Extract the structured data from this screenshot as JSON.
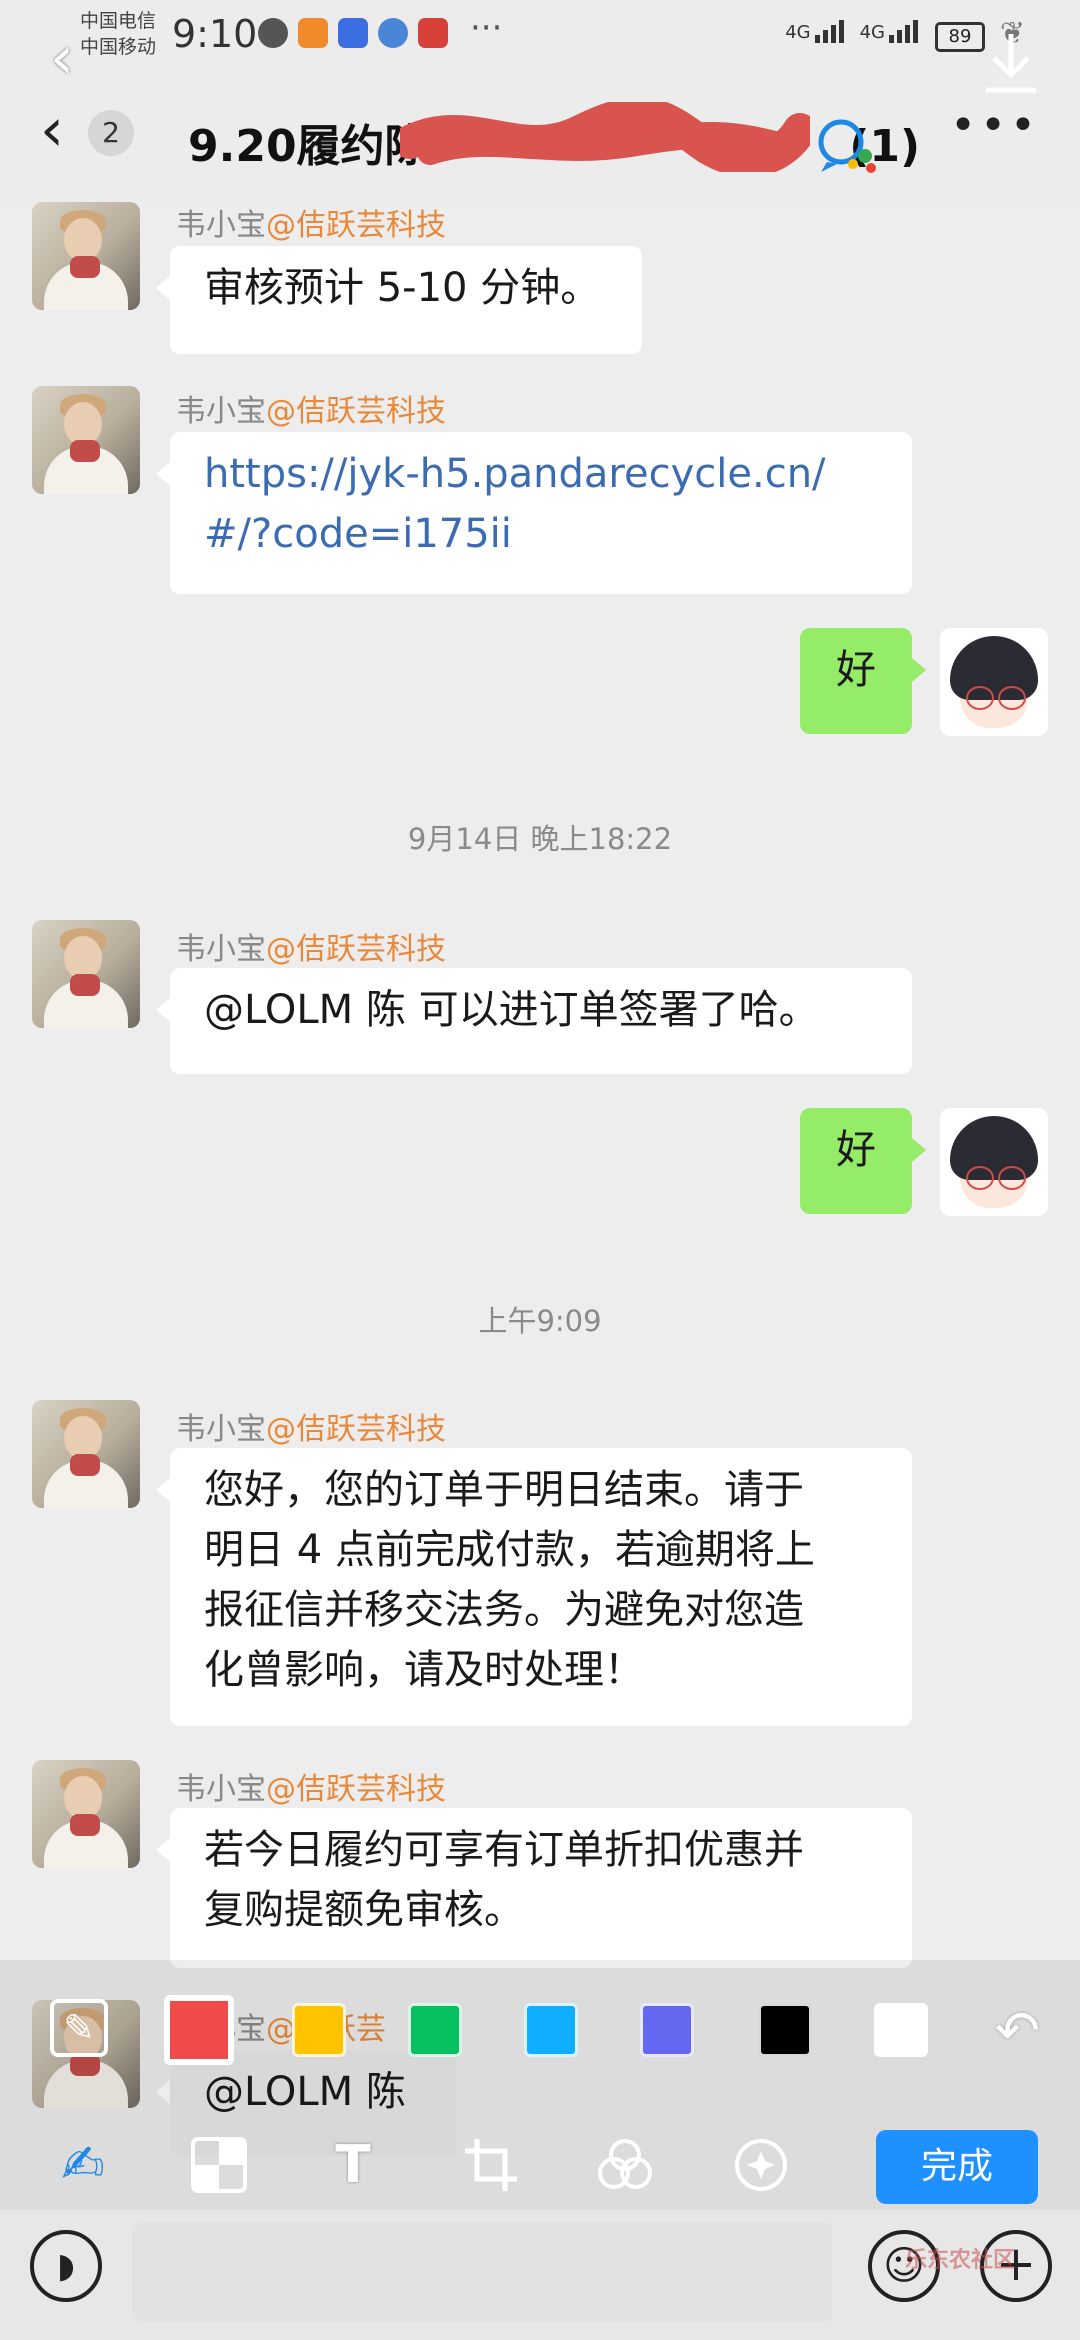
{
  "status_bar": {
    "carrier_1": "中国电信",
    "carrier_2": "中国移动",
    "time": "9:10",
    "dots": "···",
    "net_1": "4G",
    "net_2": "4G",
    "battery": "89"
  },
  "header": {
    "back_icon": "chevron-left-icon",
    "unread_count": "2",
    "title_visible": "9.20履约陈",
    "title_tail": "(1)",
    "more_label": "•••"
  },
  "messages": [
    {
      "sender": "韦小宝",
      "org": "@佶跃芸科技",
      "text": "审核预计 5-10 分钟。"
    },
    {
      "sender": "韦小宝",
      "org": "@佶跃芸科技",
      "line1": "https://jyk-h5.pandarecycle.cn/",
      "line2": "#/?code=i175ii"
    },
    {
      "from_me": true,
      "text": "好"
    },
    {
      "timestamp": "9月14日 晚上18:22"
    },
    {
      "sender": "韦小宝",
      "org": "@佶跃芸科技",
      "text": "@LOLM 陈 可以进订单签署了哈。"
    },
    {
      "from_me": true,
      "text": "好"
    },
    {
      "timestamp": "上午9:09"
    },
    {
      "sender": "韦小宝",
      "org": "@佶跃芸科技",
      "line1": "您好，您的订单于明日结束。请于",
      "line2": "明日 4 点前完成付款，若逾期将上",
      "line3": "报征信并移交法务。为避免对您造",
      "line4": "化曾影响，请及时处理！"
    },
    {
      "sender": "韦小宝",
      "org": "@佶跃芸科技",
      "line1": "若今日履约可享有订单折扣优惠并",
      "line2": "复购提额免审核。"
    },
    {
      "sender": "韦小宝",
      "org": "@佶跃芸",
      "text": "@LOLM 陈"
    }
  ],
  "editor": {
    "palette": [
      "#f04a4a",
      "#ffc300",
      "#07c160",
      "#10aeff",
      "#6467f0",
      "#000000",
      "#ffffff"
    ],
    "selected_color": "#f04a4a",
    "done_label": "完成",
    "tools": [
      "pen-icon",
      "mosaic-icon",
      "text-icon",
      "crop-icon",
      "filter-icon",
      "sticker-icon"
    ]
  },
  "input_bar": {
    "voice_icon": "voice-icon",
    "emoji_icon": "emoji-icon",
    "plus_icon": "plus-icon",
    "watermark": "乐东农社区"
  }
}
